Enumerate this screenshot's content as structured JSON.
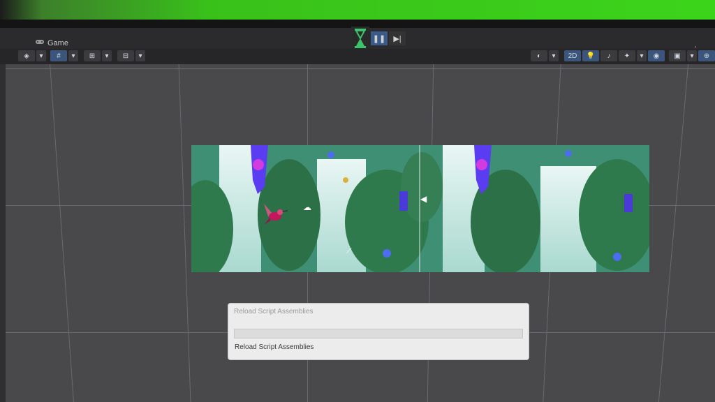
{
  "window": {
    "tab_label": "Game",
    "tab_icon": "gamepad-icon",
    "menu_icon": "kebab-menu-icon"
  },
  "playbar": {
    "status_icon": "hourglass-icon",
    "pause_label": "❚❚",
    "step_label": "▶|",
    "hourglass_color": "#3cc46a"
  },
  "toolbar": {
    "left_tools": [
      {
        "name": "transform-tool",
        "icon": "◈"
      },
      {
        "name": "grid-snap-tool",
        "icon": "#"
      },
      {
        "name": "increment-snap-tool",
        "icon": "⊞"
      },
      {
        "name": "layout-tool",
        "icon": "⊟"
      }
    ],
    "right_tools": [
      {
        "name": "shading-mode",
        "icon": "◐"
      },
      {
        "name": "2d-toggle",
        "icon": "2D"
      },
      {
        "name": "lighting-toggle",
        "icon": "💡"
      },
      {
        "name": "audio-toggle",
        "icon": "♪"
      },
      {
        "name": "effects-toggle",
        "icon": "✦"
      },
      {
        "name": "hidden-objects-toggle",
        "icon": "◉"
      },
      {
        "name": "camera-toggle",
        "icon": "▣"
      },
      {
        "name": "gizmos-toggle",
        "icon": "⊕"
      }
    ]
  },
  "dialog": {
    "title": "Reload Script Assemblies",
    "status": "Reload Script Assemblies",
    "progress": 0
  },
  "colors": {
    "scene_bg": "#49494c",
    "grid": "#6a6a6e",
    "accent_blue": "#3c557a",
    "hummingbird": "#c2185b",
    "crystal": "#5a3df0"
  }
}
